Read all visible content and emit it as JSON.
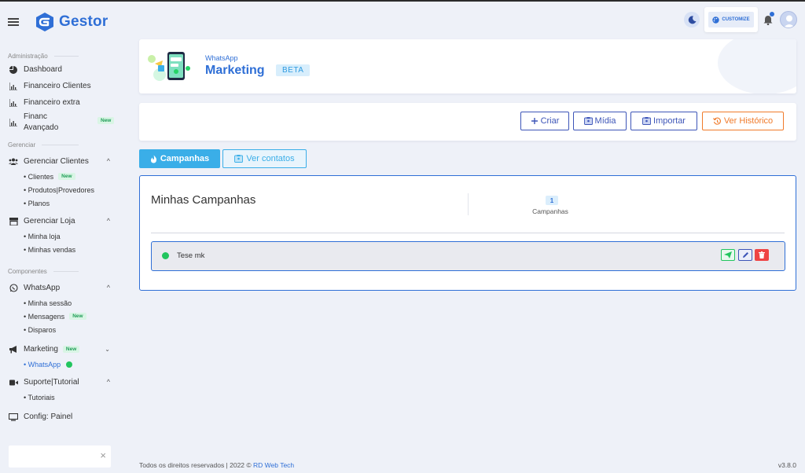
{
  "brand": {
    "name": "Gestor"
  },
  "topbar": {
    "customize_label": "CUSTOMIZE"
  },
  "sidebar": {
    "sections": {
      "admin": "Administração",
      "gerenciar": "Gerenciar",
      "componentes": "Componentes"
    },
    "dashboard": "Dashboard",
    "financeiro_clientes": "Financeiro Clientes",
    "financeiro_extra": "Financeiro extra",
    "financ_avancado_1": "Financ",
    "financ_avancado_2": "Avançado",
    "new_badge": "New",
    "gerenciar_clientes": "Gerenciar Clientes",
    "clientes": "• Clientes",
    "produtos": "• Produtos|Provedores",
    "planos": "• Planos",
    "gerenciar_loja": "Gerenciar Loja",
    "minha_loja": "• Minha loja",
    "minhas_vendas": "• Minhas vendas",
    "whatsapp": "WhatsApp",
    "minha_sessao": "• Minha sessão",
    "mensagens": "• Mensagens",
    "disparos": "• Disparos",
    "marketing": "Marketing",
    "marketing_whatsapp": "• WhatsApp",
    "suporte": "Suporte|Tutorial",
    "tutoriais": "• Tutoriais",
    "config": "Config: Painel",
    "search_close": "×"
  },
  "header": {
    "subtitle": "WhatsApp",
    "title": "Marketing",
    "badge": "BETA"
  },
  "actions": {
    "criar": "Criar",
    "midia": "Mídia",
    "importar": "Importar",
    "historico": "Ver Histórico"
  },
  "tabs": {
    "campanhas": "Campanhas",
    "contatos": "Ver contatos"
  },
  "panel": {
    "title": "Minhas Campanhas",
    "count": "1",
    "count_label": "Campanhas",
    "campaigns": [
      {
        "name": "Tese mk",
        "status_color": "#22c55e"
      }
    ]
  },
  "footer": {
    "copyright": "Todos os direitos reservados | 2022 © ",
    "company": "RD Web Tech",
    "version": "v3.8.0"
  },
  "colors": {
    "primary": "#2f6fd6",
    "accent_blue": "#3aaee8",
    "history_orange": "#f07a2a",
    "danger": "#ef4444",
    "success": "#22c55e"
  }
}
